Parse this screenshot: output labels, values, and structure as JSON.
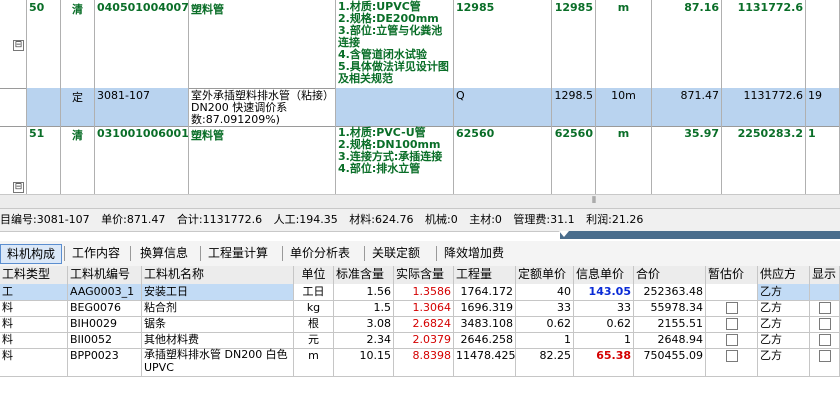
{
  "top_rows": [
    {
      "toggle": "⊟",
      "seq": "50",
      "type": "清",
      "code": "040501004007",
      "name": "塑料管",
      "desc": [
        "1.材质:UPVC管",
        "2.规格:DE200mm",
        "3.部位:立管与化粪池连接",
        "4.含管道闭水试验",
        "5.具体做法详见设计图及相关规范"
      ],
      "qty_expr": "12985",
      "qty": "12985",
      "unit": "m",
      "price": "87.16",
      "total": "1131772.6",
      "extra": ""
    },
    {
      "toggle": "",
      "seq": "",
      "type": "定",
      "code": "3081-107",
      "badge": "Bz",
      "name": "室外承插塑料排水管（粘接）DN200  快速调价系数:87.091209%)",
      "desc": [],
      "qty_expr": "Q",
      "qty": "1298.5",
      "unit": "10m",
      "price": "871.47",
      "total": "1131772.6",
      "extra": "19"
    },
    {
      "toggle": "⊟",
      "seq": "51",
      "type": "清",
      "code": "031001006001",
      "name": "塑料管",
      "desc": [
        "1.材质:PVC-U管",
        "2.规格:DN100mm",
        "3.连接方式:承插连接",
        "4.部位:排水立管"
      ],
      "qty_expr": "62560",
      "qty": "62560",
      "unit": "m",
      "price": "35.97",
      "total": "2250283.2",
      "extra": "1"
    }
  ],
  "status": {
    "code": "目编号:3081-107",
    "unit_price": "单价:871.47",
    "total": "合计:1131772.6",
    "labor": "人工:194.35",
    "material": "材料:624.76",
    "machine": "机械:0",
    "main_material": "主材:0",
    "management": "管理费:31.1",
    "profit": "利润:21.26"
  },
  "tabs": [
    "料机构成",
    "工作内容",
    "换算信息",
    "工程量计算",
    "单价分析表",
    "关联定额",
    "降效增加费"
  ],
  "bottom": {
    "headers": [
      "工料类型",
      "工料机编号",
      "工料机名称",
      "单位",
      "标准含量",
      "实际含量",
      "工程量",
      "定额单价",
      "信息单价",
      "合价",
      "暂估价",
      "供应方",
      "显示"
    ],
    "rows": [
      {
        "kind": "工",
        "code": "AAG0003_1",
        "name": "安装工日",
        "unit": "工日",
        "std": "1.56",
        "act": "1.3586",
        "qty": "1764.172",
        "quota": "40",
        "info": "143.05",
        "sum": "252363.48",
        "est": false,
        "supplier": "乙方",
        "show": false
      },
      {
        "kind": "料",
        "code": "BEG0076",
        "name": "粘合剂",
        "unit": "kg",
        "std": "1.5",
        "act": "1.3064",
        "qty": "1696.319",
        "quota": "33",
        "info": "33",
        "sum": "55978.34",
        "est": true,
        "supplier": "乙方",
        "show": true
      },
      {
        "kind": "料",
        "code": "BIH0029",
        "name": "锯条",
        "unit": "根",
        "std": "3.08",
        "act": "2.6824",
        "qty": "3483.108",
        "quota": "0.62",
        "info": "0.62",
        "sum": "2155.51",
        "est": true,
        "supplier": "乙方",
        "show": true
      },
      {
        "kind": "料",
        "code": "BII0052",
        "name": "其他材料费",
        "unit": "元",
        "std": "2.34",
        "act": "2.0379",
        "qty": "2646.258",
        "quota": "1",
        "info": "1",
        "sum": "2648.94",
        "est": true,
        "supplier": "乙方",
        "show": true
      },
      {
        "kind": "料",
        "code": "BPP0023",
        "name": "承插塑料排水管 DN200 白色UPVC",
        "unit": "m",
        "std": "10.15",
        "act": "8.8398",
        "qty": "11478.425",
        "quota": "82.25",
        "info": "65.38",
        "sum": "750455.09",
        "est": true,
        "supplier": "乙方",
        "show": true
      }
    ]
  },
  "colors": {
    "selection": "#c2dbf5",
    "accent_blue": "#0a2bd6",
    "accent_red": "#d40000",
    "green_text": "#0a6e28"
  }
}
